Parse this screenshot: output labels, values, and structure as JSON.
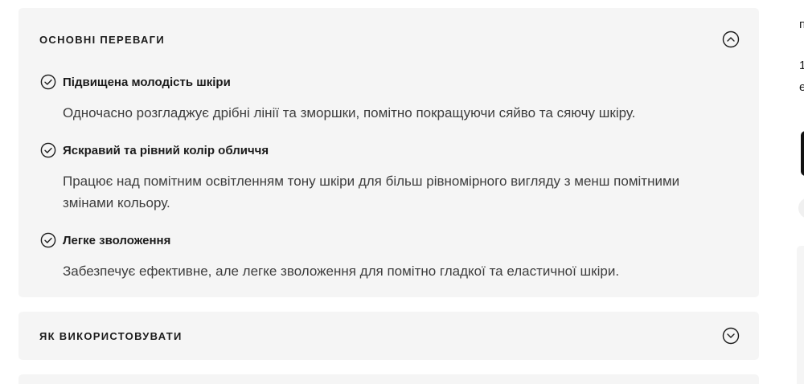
{
  "accordions": {
    "benefits": {
      "title": "ОСНОВНІ ПЕРЕВАГИ",
      "state": "expanded",
      "toggle_icon": "chevron-up-icon",
      "items": [
        {
          "icon": "check-circle-icon",
          "title": "Підвищена молодість шкіри",
          "description": "Одночасно розгладжує дрібні лінії та зморшки, помітно покращуючи сяйво та сяючу шкіру."
        },
        {
          "icon": "check-circle-icon",
          "title": "Яскравий та рівний колір обличчя",
          "description": "Працює над помітним освітленням тону шкіри для більш рівномірного вигляду з менш помітними змінами кольору."
        },
        {
          "icon": "check-circle-icon",
          "title": "Легке зволоження",
          "description": "Забезпечує ефективне, але легке зволоження для помітно гладкої та еластичної шкіри."
        }
      ]
    },
    "usage": {
      "title": "ЯК ВИКОРИСТОВУВАТИ",
      "state": "collapsed",
      "toggle_icon": "chevron-down-icon"
    }
  },
  "edge_fragments": {
    "line1": "п",
    "line2": "1",
    "line3": "е"
  },
  "colors": {
    "panel_background": "#f5f5f5",
    "text_primary": "#1b1b1b",
    "text_secondary": "#3d3d3d"
  }
}
